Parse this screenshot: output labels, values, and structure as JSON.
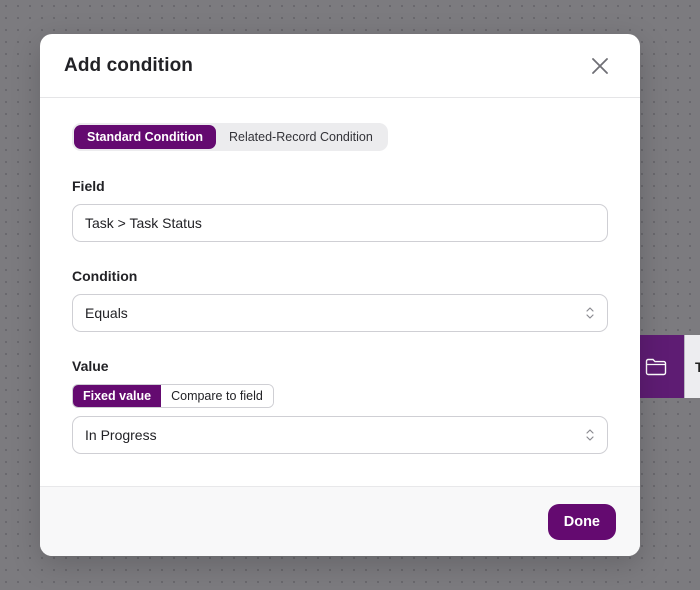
{
  "modal": {
    "title": "Add condition",
    "close_icon": "close-icon"
  },
  "condition_type_tabs": [
    {
      "label": "Standard Condition",
      "active": true
    },
    {
      "label": "Related-Record Condition",
      "active": false
    }
  ],
  "field": {
    "label": "Field",
    "value": "Task > Task Status"
  },
  "condition": {
    "label": "Condition",
    "value": "Equals",
    "icon": "chevron-up-down-icon"
  },
  "value_section": {
    "label": "Value",
    "toggle": [
      {
        "label": "Fixed value",
        "active": true
      },
      {
        "label": "Compare to field",
        "active": false
      }
    ],
    "value": "In Progress",
    "icon": "chevron-up-down-icon"
  },
  "footer": {
    "done_label": "Done"
  },
  "background_node": {
    "icon": "folder-icon",
    "label_fragment": "T"
  },
  "colors": {
    "accent": "#640a70",
    "overlay": "#7c7b7f"
  }
}
